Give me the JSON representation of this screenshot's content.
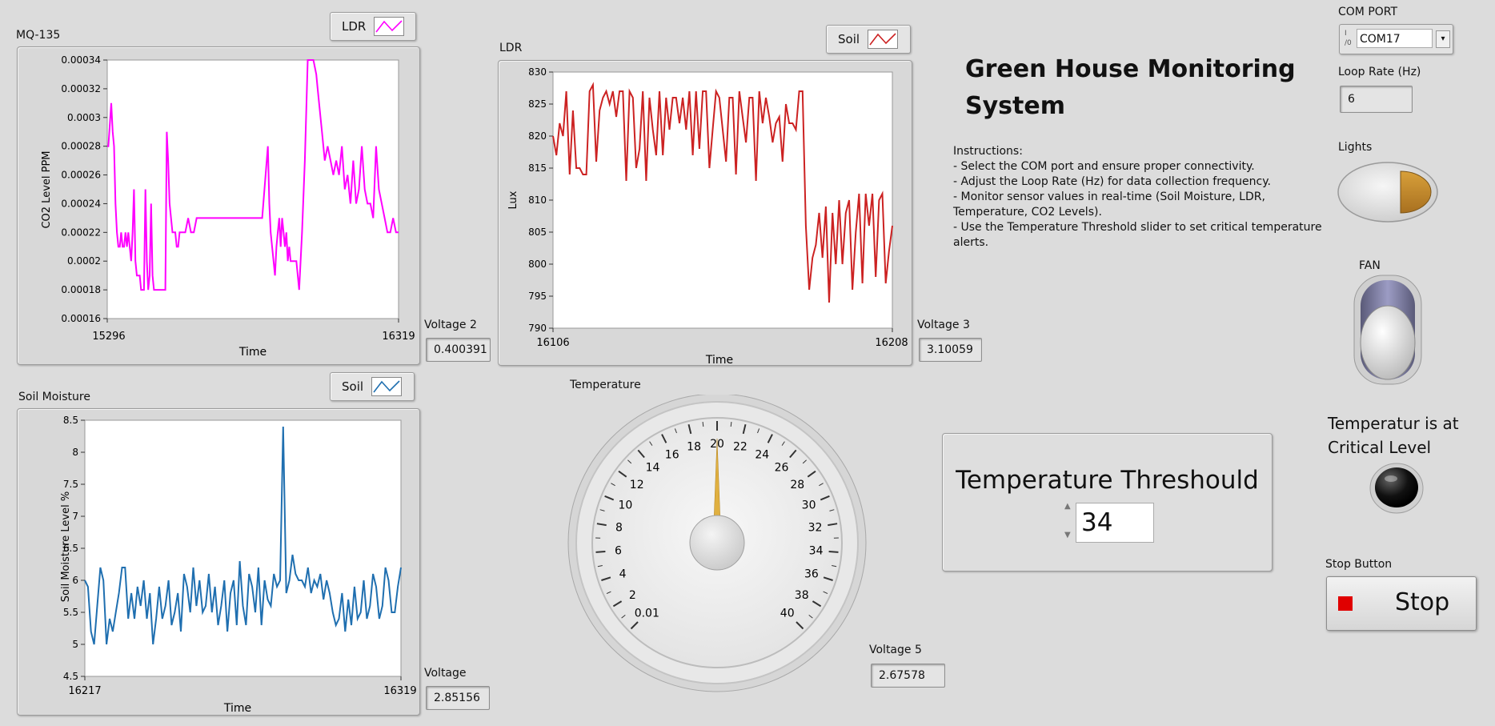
{
  "mq135": {
    "label": "MQ-135",
    "legend": "LDR",
    "ylabel": "CO2 Level PPM",
    "xlabel": "Time",
    "x_min": "15296",
    "x_max": "16319",
    "ticks": [
      "0.00034",
      "0.00032",
      "0.0003",
      "0.00028",
      "0.00026",
      "0.00024",
      "0.00022",
      "0.0002",
      "0.00018",
      "0.00016"
    ],
    "color": "#ff00ff"
  },
  "ldr": {
    "label": "LDR",
    "legend": "Soil",
    "ylabel": "Lux",
    "xlabel": "Time",
    "x_min": "16106",
    "x_max": "16208",
    "ticks": [
      "830",
      "825",
      "820",
      "815",
      "810",
      "805",
      "800",
      "795",
      "790"
    ],
    "color": "#cc2222"
  },
  "soil": {
    "label": "Soil Moisture",
    "legend": "Soil",
    "ylabel": "Soil Moisture Level %",
    "xlabel": "Time",
    "x_min": "16217",
    "x_max": "16319",
    "ticks": [
      "8.5",
      "8",
      "7.5",
      "7",
      "6.5",
      "6",
      "5.5",
      "5",
      "4.5"
    ],
    "color": "#1f6fb0"
  },
  "voltages": {
    "v2_label": "Voltage 2",
    "v2_value": "0.400391",
    "v3_label": "Voltage 3",
    "v3_value": "3.10059",
    "v_label": "Voltage",
    "v_value": "2.85156",
    "v5_label": "Voltage 5",
    "v5_value": "2.67578"
  },
  "temperature": {
    "label": "Temperature",
    "value": 20,
    "scale": [
      "0.01",
      "2",
      "4",
      "6",
      "8",
      "10",
      "12",
      "14",
      "16",
      "18",
      "20",
      "22",
      "24",
      "26",
      "28",
      "30",
      "32",
      "34",
      "36",
      "38",
      "40"
    ]
  },
  "header": {
    "title_line1": "Green House Monitoring",
    "title_line2": "System"
  },
  "instructions": [
    "Instructions:",
    "- Select the COM port and ensure proper connectivity.",
    "- Adjust the Loop Rate (Hz) for data collection frequency.",
    "- Monitor sensor values in real-time (Soil Moisture, LDR,",
    "Temperature, CO2 Levels).",
    "- Use the Temperature Threshold slider to set critical temperature",
    "alerts."
  ],
  "threshold": {
    "label": "Temperature Threshould",
    "value": "34"
  },
  "controls": {
    "com_port_label": "COM PORT",
    "com_port_value": "COM17",
    "loop_rate_label": "Loop Rate (Hz)",
    "loop_rate_value": "6",
    "lights_label": "Lights",
    "fan_label": "FAN",
    "critical_line1": "Temperatur is at",
    "critical_line2": "Critical  Level",
    "stop_label": "Stop Button",
    "stop_button": "Stop"
  },
  "colors": {
    "background": "#dcdcdc",
    "lights_on": "#c8902a",
    "gauge_needle": "#e0b040",
    "stop_red": "#e00000"
  },
  "chart_data": [
    {
      "type": "line",
      "title": "MQ-135",
      "xlabel": "Time",
      "ylabel": "CO2 Level PPM",
      "xlim": [
        15296,
        16319
      ],
      "ylim": [
        0.00016,
        0.00034
      ],
      "series": [
        {
          "name": "LDR",
          "x": [
            15296,
            15300,
            15310,
            15315,
            15320,
            15325,
            15330,
            15335,
            15340,
            15345,
            15350,
            15355,
            15360,
            15365,
            15370,
            15375,
            15380,
            15385,
            15390,
            15395,
            15400,
            15405,
            15410,
            15415,
            15420,
            15425,
            15430,
            15435,
            15440,
            15445,
            15450,
            15455,
            15460,
            15465,
            15470,
            15475,
            15480,
            15485,
            15490,
            15495,
            15500,
            15505,
            15510,
            15515,
            15520,
            15525,
            15530,
            15535,
            15540,
            15545,
            15550,
            15555,
            15560,
            15570,
            15580,
            15590,
            15600,
            15610,
            15620,
            15625,
            15630,
            15640,
            15650,
            15660,
            15670,
            15680,
            15690,
            15700,
            15720,
            15740,
            15760,
            15780,
            15800,
            15820,
            15840,
            15860,
            15865,
            15870,
            15875,
            15880,
            15885,
            15890,
            15895,
            15900,
            15905,
            15910,
            15915,
            15920,
            15925,
            15930,
            15935,
            15940,
            15945,
            15950,
            15960,
            15970,
            15980,
            15990,
            16000,
            16010,
            16020,
            16030,
            16035,
            16040,
            16045,
            16050,
            16060,
            16070,
            16080,
            16090,
            16100,
            16110,
            16120,
            16130,
            16140,
            16150,
            16160,
            16170,
            16180,
            16190,
            16200,
            16210,
            16220,
            16230,
            16240,
            16250,
            16260,
            16270,
            16280,
            16290,
            16300,
            16310,
            16319
          ],
          "values": [
            0.00028,
            0.00028,
            0.00031,
            0.00029,
            0.00028,
            0.00024,
            0.00022,
            0.00021,
            0.00021,
            0.00022,
            0.00021,
            0.00021,
            0.00022,
            0.00021,
            0.00022,
            0.00021,
            0.0002,
            0.00022,
            0.00025,
            0.0002,
            0.00019,
            0.00019,
            0.00019,
            0.00018,
            0.00018,
            0.00018,
            0.00025,
            0.0002,
            0.00018,
            0.00019,
            0.00024,
            0.00019,
            0.00018,
            0.00018,
            0.00018,
            0.00018,
            0.00018,
            0.00018,
            0.00018,
            0.00018,
            0.00018,
            0.00029,
            0.00027,
            0.00024,
            0.00023,
            0.00022,
            0.00022,
            0.00022,
            0.00021,
            0.00021,
            0.00022,
            0.00022,
            0.00022,
            0.00022,
            0.00023,
            0.00022,
            0.00022,
            0.00023,
            0.00023,
            0.00023,
            0.00023,
            0.00023,
            0.00023,
            0.00023,
            0.00023,
            0.00023,
            0.00023,
            0.00023,
            0.00023,
            0.00023,
            0.00023,
            0.00023,
            0.00023,
            0.00023,
            0.00023,
            0.00028,
            0.00024,
            0.00022,
            0.00021,
            0.0002,
            0.00019,
            0.00021,
            0.00022,
            0.00023,
            0.00021,
            0.00023,
            0.00022,
            0.00021,
            0.00022,
            0.0002,
            0.00021,
            0.0002,
            0.0002,
            0.0002,
            0.0002,
            0.00018,
            0.00022,
            0.00027,
            0.00034,
            0.00034,
            0.00034,
            0.00033,
            0.00032,
            0.00031,
            0.0003,
            0.00029,
            0.00027,
            0.00028,
            0.00027,
            0.00026,
            0.00027,
            0.00026,
            0.00028,
            0.00025,
            0.00026,
            0.00024,
            0.00027,
            0.00024,
            0.00025,
            0.00028,
            0.00025,
            0.00024,
            0.00024,
            0.00023,
            0.00028,
            0.00025,
            0.00024,
            0.00023,
            0.00022,
            0.00022,
            0.00023,
            0.00022,
            0.00022
          ]
        }
      ]
    },
    {
      "type": "line",
      "title": "LDR",
      "xlabel": "Time",
      "ylabel": "Lux",
      "xlim": [
        16106,
        16208
      ],
      "ylim": [
        790,
        830
      ],
      "series": [
        {
          "name": "Soil",
          "x": [
            16106,
            16107,
            16108,
            16109,
            16110,
            16111,
            16112,
            16113,
            16114,
            16115,
            16116,
            16117,
            16118,
            16119,
            16120,
            16121,
            16122,
            16123,
            16124,
            16125,
            16126,
            16127,
            16128,
            16129,
            16130,
            16131,
            16132,
            16133,
            16134,
            16135,
            16136,
            16137,
            16138,
            16139,
            16140,
            16141,
            16142,
            16143,
            16144,
            16145,
            16146,
            16147,
            16148,
            16149,
            16150,
            16151,
            16152,
            16153,
            16154,
            16155,
            16156,
            16157,
            16158,
            16159,
            16160,
            16161,
            16162,
            16163,
            16164,
            16165,
            16166,
            16167,
            16168,
            16169,
            16170,
            16171,
            16172,
            16173,
            16174,
            16175,
            16176,
            16177,
            16178,
            16179,
            16180,
            16181,
            16182,
            16183,
            16184,
            16185,
            16186,
            16187,
            16188,
            16189,
            16190,
            16191,
            16192,
            16193,
            16194,
            16195,
            16196,
            16197,
            16198,
            16199,
            16200,
            16201,
            16202,
            16203,
            16204,
            16205,
            16206,
            16207,
            16208
          ],
          "values": [
            820,
            817,
            822,
            820,
            827,
            814,
            824,
            815,
            815,
            814,
            814,
            827,
            828,
            816,
            824,
            826,
            827,
            825,
            827,
            823,
            827,
            827,
            813,
            827,
            826,
            815,
            818,
            827,
            813,
            826,
            821,
            817,
            827,
            817,
            826,
            821,
            826,
            826,
            822,
            826,
            821,
            827,
            817,
            827,
            818,
            827,
            827,
            815,
            821,
            827,
            826,
            821,
            816,
            826,
            826,
            814,
            827,
            823,
            819,
            826,
            826,
            813,
            827,
            822,
            826,
            823,
            819,
            822,
            823,
            816,
            825,
            822,
            822,
            821,
            827,
            827,
            806,
            796,
            801,
            803,
            808,
            801,
            809,
            794,
            808,
            800,
            810,
            800,
            808,
            810,
            796,
            805,
            811,
            797,
            811,
            806,
            811,
            798,
            810,
            811,
            797,
            802,
            806
          ]
        }
      ]
    },
    {
      "type": "line",
      "title": "Soil Moisture",
      "xlabel": "Time",
      "ylabel": "Soil Moisture Level %",
      "xlim": [
        16217,
        16319
      ],
      "ylim": [
        4.5,
        8.5
      ],
      "series": [
        {
          "name": "Soil",
          "x": [
            16217,
            16218,
            16219,
            16220,
            16221,
            16222,
            16223,
            16224,
            16225,
            16226,
            16227,
            16228,
            16229,
            16230,
            16231,
            16232,
            16233,
            16234,
            16235,
            16236,
            16237,
            16238,
            16239,
            16240,
            16241,
            16242,
            16243,
            16244,
            16245,
            16246,
            16247,
            16248,
            16249,
            16250,
            16251,
            16252,
            16253,
            16254,
            16255,
            16256,
            16257,
            16258,
            16259,
            16260,
            16261,
            16262,
            16263,
            16264,
            16265,
            16266,
            16267,
            16268,
            16269,
            16270,
            16271,
            16272,
            16273,
            16274,
            16275,
            16276,
            16277,
            16278,
            16279,
            16280,
            16281,
            16282,
            16283,
            16284,
            16285,
            16286,
            16287,
            16288,
            16289,
            16290,
            16291,
            16292,
            16293,
            16294,
            16295,
            16296,
            16297,
            16298,
            16299,
            16300,
            16301,
            16302,
            16303,
            16304,
            16305,
            16306,
            16307,
            16308,
            16309,
            16310,
            16311,
            16312,
            16313,
            16314,
            16315,
            16316,
            16317,
            16318,
            16319
          ],
          "values": [
            6.0,
            5.9,
            5.2,
            5.0,
            5.6,
            6.2,
            6.0,
            5.0,
            5.4,
            5.2,
            5.5,
            5.8,
            6.2,
            6.2,
            5.4,
            5.8,
            5.4,
            5.9,
            5.6,
            6.0,
            5.4,
            5.8,
            5.0,
            5.4,
            5.9,
            5.4,
            5.6,
            6.0,
            5.3,
            5.5,
            5.8,
            5.2,
            6.1,
            5.9,
            5.5,
            6.2,
            5.6,
            6.0,
            5.5,
            5.6,
            6.1,
            5.5,
            5.9,
            5.3,
            5.6,
            6.0,
            5.2,
            5.8,
            6.0,
            5.3,
            6.3,
            5.6,
            5.3,
            6.1,
            5.9,
            5.5,
            6.2,
            5.3,
            6.0,
            5.7,
            5.6,
            6.1,
            5.9,
            6.0,
            8.4,
            5.8,
            6.0,
            6.4,
            6.1,
            6.0,
            6.0,
            5.9,
            6.2,
            5.8,
            6.0,
            5.9,
            6.1,
            5.7,
            6.0,
            5.8,
            5.5,
            5.3,
            5.4,
            5.8,
            5.2,
            5.7,
            5.3,
            5.9,
            5.4,
            5.5,
            6.0,
            5.4,
            5.6,
            6.1,
            5.9,
            5.4,
            5.6,
            6.2,
            6.0,
            5.5,
            5.5,
            5.9,
            6.2
          ]
        }
      ]
    }
  ]
}
